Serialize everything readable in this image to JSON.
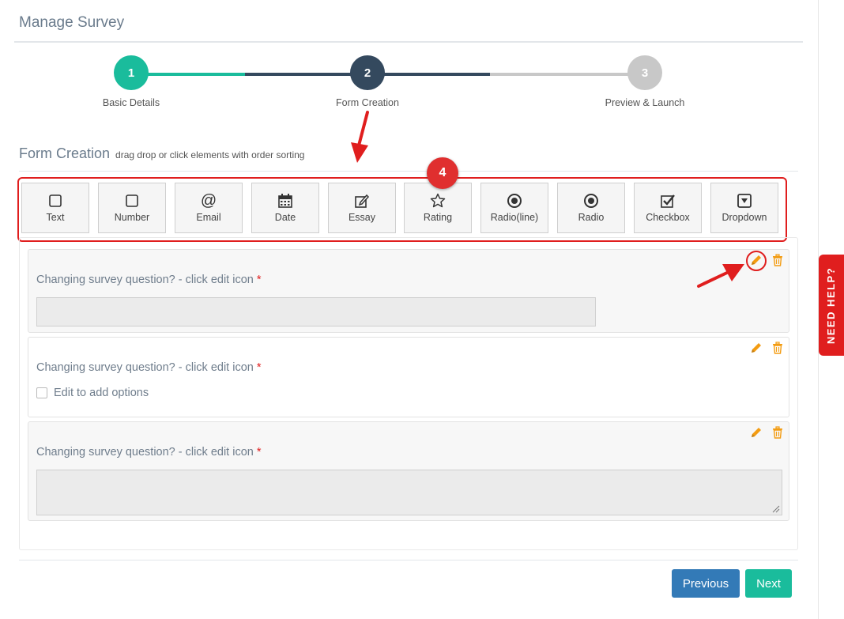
{
  "page": {
    "title": "Manage Survey"
  },
  "stepper": {
    "steps": [
      {
        "number": "1",
        "label": "Basic Details",
        "state": "complete"
      },
      {
        "number": "2",
        "label": "Form Creation",
        "state": "active"
      },
      {
        "number": "3",
        "label": "Preview & Launch",
        "state": "pending"
      }
    ]
  },
  "section": {
    "title": "Form Creation",
    "subtitle": "drag drop or click elements with order sorting"
  },
  "annotation": {
    "badge": "4"
  },
  "palette": [
    {
      "label": "Text",
      "icon": "square-icon"
    },
    {
      "label": "Number",
      "icon": "square-icon"
    },
    {
      "label": "Email",
      "icon": "at-icon"
    },
    {
      "label": "Date",
      "icon": "calendar-icon"
    },
    {
      "label": "Essay",
      "icon": "edit-icon"
    },
    {
      "label": "Rating",
      "icon": "star-icon"
    },
    {
      "label": "Radio(line)",
      "icon": "radio-icon"
    },
    {
      "label": "Radio",
      "icon": "radio-icon"
    },
    {
      "label": "Checkbox",
      "icon": "checkbox-icon"
    },
    {
      "label": "Dropdown",
      "icon": "dropdown-icon"
    }
  ],
  "questions": [
    {
      "label": "Changing survey question? - click edit icon",
      "required": "*",
      "type": "text"
    },
    {
      "label": "Changing survey question? - click edit icon",
      "required": "*",
      "type": "checkbox",
      "option": "Edit to add options"
    },
    {
      "label": "Changing survey question? - click edit icon",
      "required": "*",
      "type": "essay"
    }
  ],
  "buttons": {
    "previous": "Previous",
    "next": "Next"
  },
  "help": {
    "label": "NEED HELP?"
  },
  "colors": {
    "complete": "#1abc9c",
    "active": "#34495e",
    "pending": "#c8c8c8",
    "primary": "#337ab7",
    "success": "#1abc9c",
    "action": "#f39c12",
    "highlight": "#e01e1e"
  }
}
